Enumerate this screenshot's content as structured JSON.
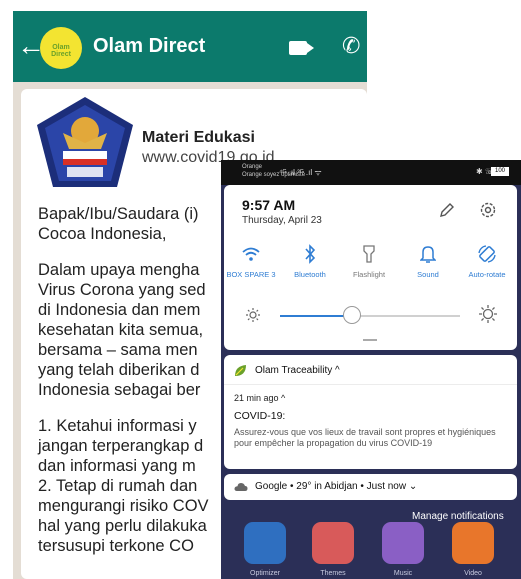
{
  "chat": {
    "contact_name": "Olam Direct",
    "logo_text": "Olam Direct",
    "link_preview": {
      "title": "Materi Edukasi",
      "url": "www.covid19.go.id"
    },
    "message_lines": [
      "Bapak/Ibu/Saudara (i)",
      "Cocoa Indonesia,",
      "",
      "Dalam upaya mengha",
      "Virus Corona yang sed",
      "di Indonesia dan mem",
      "kesehatan kita semua,",
      "bersama – sama men",
      "yang telah diberikan d",
      "Indonesia sebagai ber",
      "",
      "1. Ketahui informasi y",
      "jangan terperangkap d",
      "dan informasi yang m",
      "2. Tetap di rumah dan",
      "mengurangi risiko COV",
      "hal yang perlu dilakuka",
      "tersusupi terkone CO"
    ]
  },
  "shade": {
    "status": {
      "carrier_1": "Orange",
      "carrier_2": "Orange soyez optimiste",
      "signal": "⁴ᴳ .ıl ³ᴳ .ıl ᯤ",
      "right_icons": "✱ ☏",
      "battery": "100"
    },
    "time": "9:57 AM",
    "date": "Thursday, April 23",
    "tiles": [
      {
        "label": "BOX SPARE 3",
        "icon": "wifi-icon"
      },
      {
        "label": "Bluetooth",
        "icon": "bluetooth-icon"
      },
      {
        "label": "Flashlight",
        "icon": "flashlight-icon"
      },
      {
        "label": "Sound",
        "icon": "bell-icon"
      },
      {
        "label": "Auto-rotate",
        "icon": "rotate-icon"
      }
    ],
    "brightness_level": 0.4,
    "notification": {
      "app": "Olam Traceability",
      "chevron": "^",
      "time_ago": "21 min ago",
      "title": "COVID-19:",
      "body": "Assurez-vous que vos lieux de travail sont propres et hygiéniques pour empêcher la propagation du virus COVID-19"
    },
    "google_card": {
      "text": "Google • 29° in Abidjan • Just now"
    },
    "manage_label": "Manage notifications",
    "dock": [
      {
        "label": "Optimizer",
        "color": "#2f6fc0"
      },
      {
        "label": "Themes",
        "color": "#d85a5a"
      },
      {
        "label": "Music",
        "color": "#8a5fc5"
      },
      {
        "label": "Video",
        "color": "#e8762b"
      }
    ]
  },
  "colors": {
    "whatsapp_header": "#0c7a6c",
    "accent_blue": "#2f7dd3",
    "shade_background": "#2b2f57"
  }
}
